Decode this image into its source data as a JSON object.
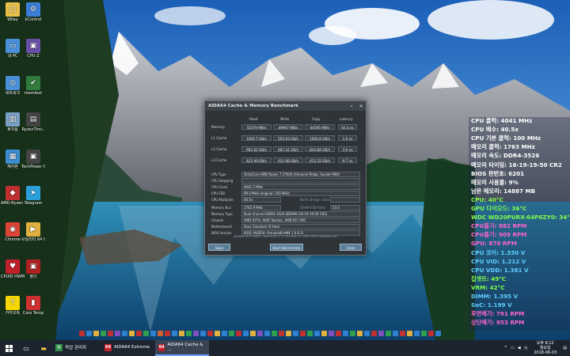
{
  "desktop": {
    "icons": [
      {
        "label": "Wiley",
        "color": "#e8c04a",
        "glyph": "▢"
      },
      {
        "label": "kControl",
        "color": "#3b7dd8",
        "glyph": "⚙"
      },
      {
        "label": "내 PC",
        "color": "#4a90d9",
        "glyph": "▭"
      },
      {
        "label": "CPU-Z",
        "color": "#6a4fa8",
        "glyph": "▣"
      },
      {
        "label": "네트워크",
        "color": "#4a90d9",
        "glyph": "◎"
      },
      {
        "label": "memtest",
        "color": "#2f7a3c",
        "glyph": "✔"
      },
      {
        "label": "휴지통",
        "color": "#7aa0c4",
        "glyph": "▥"
      },
      {
        "label": "RyzenTimi..",
        "color": "#444",
        "glyph": "▤"
      },
      {
        "label": "제어판",
        "color": "#3d8dd0",
        "glyph": "▦"
      },
      {
        "label": "TechPower GPU-Z",
        "color": "#444",
        "glyph": "▣"
      },
      {
        "label": "AMD Ryzen Master",
        "color": "#c03030",
        "glyph": "◆"
      },
      {
        "label": "Telegram",
        "color": "#2aa0da",
        "glyph": "➤"
      },
      {
        "label": "Chrome",
        "color": "#db4437",
        "glyph": "◉"
      },
      {
        "label": "유틸리티 64 비트",
        "color": "#e0b040",
        "glyph": "▶"
      },
      {
        "label": "CPUID HWMonitor",
        "color": "#c0202a",
        "glyph": "♥"
      },
      {
        "label": "폴더",
        "color": "#b02020",
        "glyph": "▣"
      },
      {
        "label": "카카오톡",
        "color": "#f7d700",
        "glyph": "T"
      },
      {
        "label": "Core Temp",
        "color": "#d03030",
        "glyph": "▮"
      }
    ]
  },
  "aida": {
    "title": "AIDA64 Cache & Memory Benchmark",
    "headers": [
      "Read",
      "Write",
      "Copy",
      "Latency"
    ],
    "rows": [
      {
        "label": "Memory",
        "read": "51079 MB/s",
        "write": "49967 MB/s",
        "copy": "44595 MB/s",
        "lat": "63.4 ns"
      },
      {
        "label": "L1 Cache",
        "read": "1004.7 GB/s",
        "write": "503.63 GB/s",
        "copy": "1004.8 GB/s",
        "lat": "1.0 ns"
      },
      {
        "label": "L2 Cache",
        "read": "991.62 GB/s",
        "write": "487.41 GB/s",
        "copy": "834.84 GB/s",
        "lat": "3.0 ns"
      },
      {
        "label": "L3 Cache",
        "read": "422.40 GB/s",
        "write": "421.66 GB/s",
        "copy": "412.25 GB/s",
        "lat": "9.7 ns"
      }
    ],
    "info": [
      {
        "label": "CPU Type",
        "value": "OctalCore AMD Ryzen 7 2700X (Pinnacle Ridge, Socket AM4)"
      },
      {
        "label": "CPU Stepping",
        "value": ""
      },
      {
        "label": "CPU Clock",
        "value": "4041.5 MHz"
      },
      {
        "label": "CPU FSB",
        "value": "99.0 MHz (original: 100 MHz)"
      },
      {
        "label": "CPU Multiplier",
        "value": "40.5x",
        "extra": "North Bridge Clock",
        "extra_value": ""
      }
    ],
    "info2": [
      {
        "label": "Memory Bus",
        "value": "1762.9 MHz",
        "extra": "DRAM:FSB Ratio",
        "extra_value": "53:3"
      },
      {
        "label": "Memory Type",
        "value": "Dual Channel DDR4-3526 SDRAM (16-19-19-50 CR2)"
      },
      {
        "label": "Chipset",
        "value": "AMD X370, AMD Taishan, AMD K17 IMC"
      },
      {
        "label": "Motherboard",
        "value": "Asus Crosshair VI Hero"
      },
      {
        "label": "BIOS Version",
        "value": "6201  (AGESA: PinnacleR-AM4 1.0.0.2)"
      }
    ],
    "footer": "AIDA64 v5.97.4600 / BenchDLL 4.3.783-x64  (c) 1995-2018 FinalWire Ltd.",
    "buttons": {
      "save": "Save",
      "start": "Start Benchmark",
      "close": "Close"
    }
  },
  "osd": {
    "lines": [
      {
        "text": "CPU 클럭: 4041 MHz",
        "color": "#ffffff"
      },
      {
        "text": "CPU 배수: 40.5x",
        "color": "#ffffff"
      },
      {
        "text": "CPU 기본 클럭: 100 MHz",
        "color": "#ffffff"
      },
      {
        "text": "메모리 클럭: 1763 MHz",
        "color": "#ffffff"
      },
      {
        "text": "메모리 속도: DDR4-3526",
        "color": "#ffffff"
      },
      {
        "text": "메모리 타이밍: 16-19-19-50 CR2",
        "color": "#ffffff"
      },
      {
        "text": "BIOS 판번호: 6201",
        "color": "#ffffff"
      },
      {
        "text": "메모리 사용율: 9%",
        "color": "#ffffff"
      },
      {
        "text": "남은 메모리: 14887 MB",
        "color": "#ffffff"
      },
      {
        "text": "CPU: 40°C",
        "color": "#7fff4a"
      },
      {
        "text": "GPU 다이오드: 36°C",
        "color": "#7fff4a"
      },
      {
        "text": "WDC WD20PURX-64P6ZY0: 34°C",
        "color": "#7fff4a"
      },
      {
        "text": "CPU풀기: 882 RPM",
        "color": "#ff66cc"
      },
      {
        "text": "CPU풀기: 909 RPM",
        "color": "#ff66cc"
      },
      {
        "text": "GPU: 870 RPM",
        "color": "#ff66cc"
      },
      {
        "text": "CPU 코어: 1.330 V",
        "color": "#5fd0ff"
      },
      {
        "text": "CPU VID: 1.212 V",
        "color": "#5fd0ff"
      },
      {
        "text": "CPU VDD: 1.381 V",
        "color": "#5fd0ff"
      },
      {
        "text": "칩셋트: 49°C",
        "color": "#7fff4a"
      },
      {
        "text": "VRM: 42°C",
        "color": "#7fff4a"
      },
      {
        "text": "DIMM: 1.395 V",
        "color": "#5fd0ff"
      },
      {
        "text": "SoC: 1.199 V",
        "color": "#5fd0ff"
      },
      {
        "text": "후면배기: 791 RPM",
        "color": "#ff66cc"
      },
      {
        "text": "상단배기: 953 RPM",
        "color": "#ff66cc"
      }
    ]
  },
  "taskbar": {
    "tasks": [
      {
        "label": "작업 관리자",
        "color": "#2f8f4a",
        "glyph": "▥"
      },
      {
        "label": "AIDA64 Extreme",
        "color": "#c0202a",
        "glyph": "64"
      },
      {
        "label": "AIDA64 Cache & ...",
        "color": "#c0202a",
        "glyph": "64"
      }
    ],
    "clock_time": "오후 8:12",
    "clock_day": "월요일",
    "clock_date": "2018-06-03",
    "lang": "가"
  }
}
